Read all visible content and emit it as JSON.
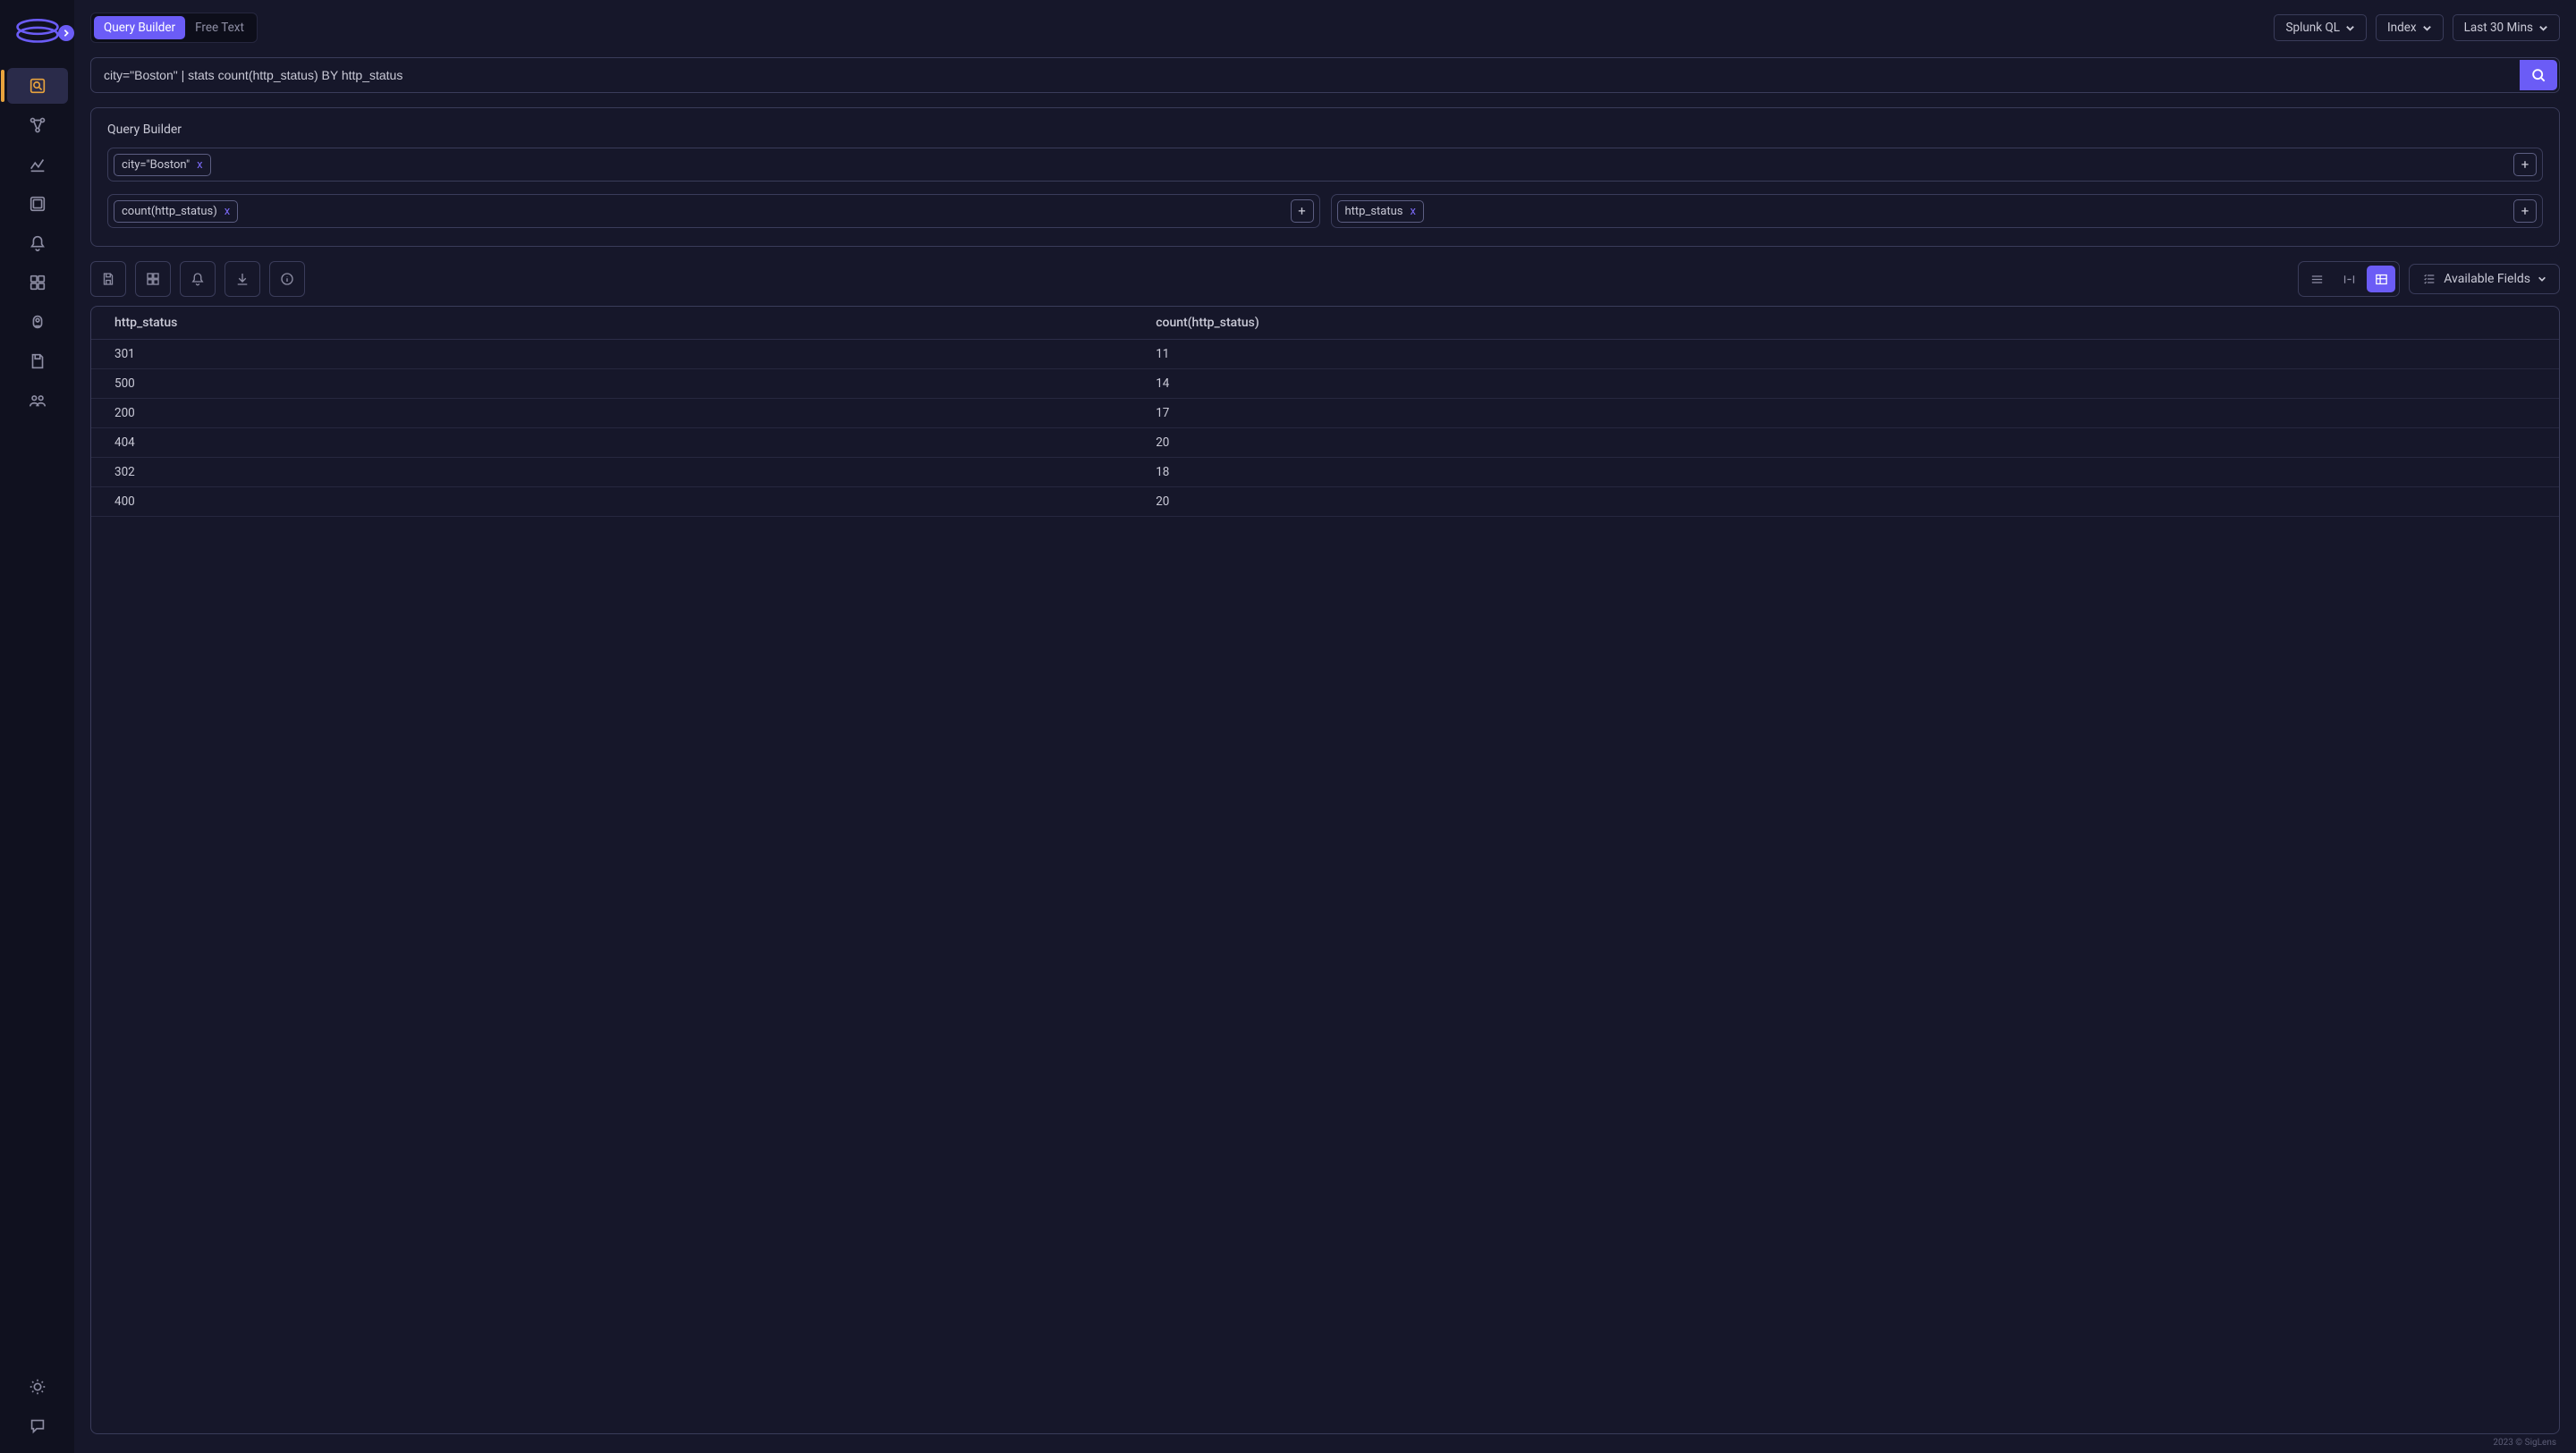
{
  "mode_tabs": {
    "query_builder": "Query Builder",
    "free_text": "Free Text"
  },
  "top_dropdowns": {
    "lang": "Splunk QL",
    "index": "Index",
    "time": "Last 30 Mins"
  },
  "search_value": "city=\"Boston\" | stats count(http_status) BY http_status",
  "builder": {
    "title": "Query Builder",
    "filter_chip": "city=\"Boston\"",
    "agg_chip": "count(http_status)",
    "by_chip": "http_status",
    "chip_x": "x",
    "plus": "+"
  },
  "fields_button": "Available Fields",
  "table": {
    "headers": [
      "http_status",
      "count(http_status)"
    ],
    "rows": [
      [
        "301",
        "11"
      ],
      [
        "500",
        "14"
      ],
      [
        "200",
        "17"
      ],
      [
        "404",
        "20"
      ],
      [
        "302",
        "18"
      ],
      [
        "400",
        "20"
      ]
    ]
  },
  "footer": "2023 © SigLens"
}
